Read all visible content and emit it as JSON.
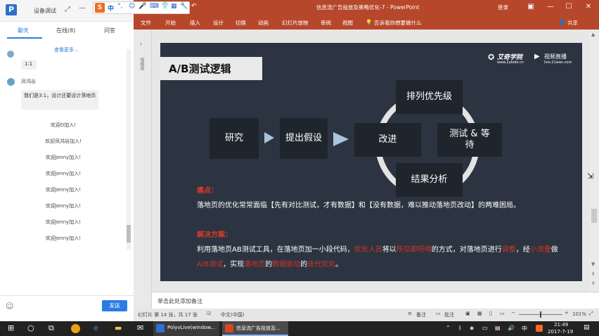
{
  "ppt": {
    "filename": "信息流广告投放及策略优化-7",
    "app_name": "PowerPoint",
    "login": "登录",
    "share": "共享",
    "ribbon_tabs": [
      "文件",
      "开始",
      "插入",
      "设计",
      "切换",
      "动画",
      "幻灯片放映",
      "审阅",
      "视图"
    ],
    "tell_me": "告诉我你想要做什么",
    "notes_placeholder": "单击此处添加备注",
    "status": {
      "slide_info": "幻灯片 第 14 张，共 17 张",
      "language": "中文(中国)",
      "notes": "备注",
      "comments": "批注",
      "zoom": "101%"
    }
  },
  "slide": {
    "title": "A/B测试逻辑",
    "logo_text": "艾奇学院",
    "logo_url": "www.2ybebr.cn",
    "logo_video": "视频直播",
    "logo_video_url": "live.21wan.com",
    "boxes": {
      "research": "研究",
      "hypothesis": "提出假设",
      "improve": "改进",
      "prioritize": "排列优先级",
      "test_wait": "测试 & 等待",
      "result": "结果分析"
    },
    "pain_label": "痛点：",
    "pain_text": "落地页的优化常常面临【先有对比测试，才有数据】和【没有数据，难以推动落地页改动】的两难困局。",
    "solution_label": "解决方案：",
    "solution_parts": {
      "p1": "利用落地页AB测试工具，在落地页加一小段代码，",
      "h1": "优化人员",
      "p2": "将以",
      "h2": "所见即所得",
      "p3": "的方式，对落地页进行",
      "h3": "调整",
      "p4": "，经",
      "h4": "小流量",
      "p5": "做",
      "h5": "A/B测试",
      "p6": "，实现",
      "h6": "落地页",
      "p7": "的",
      "h7": "数据驱动",
      "p8": "的",
      "h8": "迭代优化",
      "p9": "。"
    }
  },
  "chat": {
    "title": "设备调试",
    "tabs": [
      "聊天",
      "在线(8)",
      "问答"
    ],
    "see_more": "查看更多...",
    "messages": [
      {
        "user": "",
        "text": "1:1"
      },
      {
        "user": "凤鸿谷",
        "text": "我们是3:1，设计还要设计落地页"
      }
    ],
    "system_messages": [
      "欢迎D加入!",
      "欢迎凤鸿谷加入!",
      "欢迎Jenny加入!",
      "欢迎Jenny加入!",
      "欢迎Jenny加入!",
      "欢迎Jenny加入!",
      "欢迎Jenny加入!",
      "欢迎Jenny加入!"
    ],
    "send": "发送"
  },
  "ime": {
    "label": "中"
  },
  "taskbar": {
    "apps": [
      "PolyvLive(window...",
      "信息流广告投放及..."
    ],
    "time": "21:49",
    "date": "2017-7-19",
    "ime": "中"
  }
}
